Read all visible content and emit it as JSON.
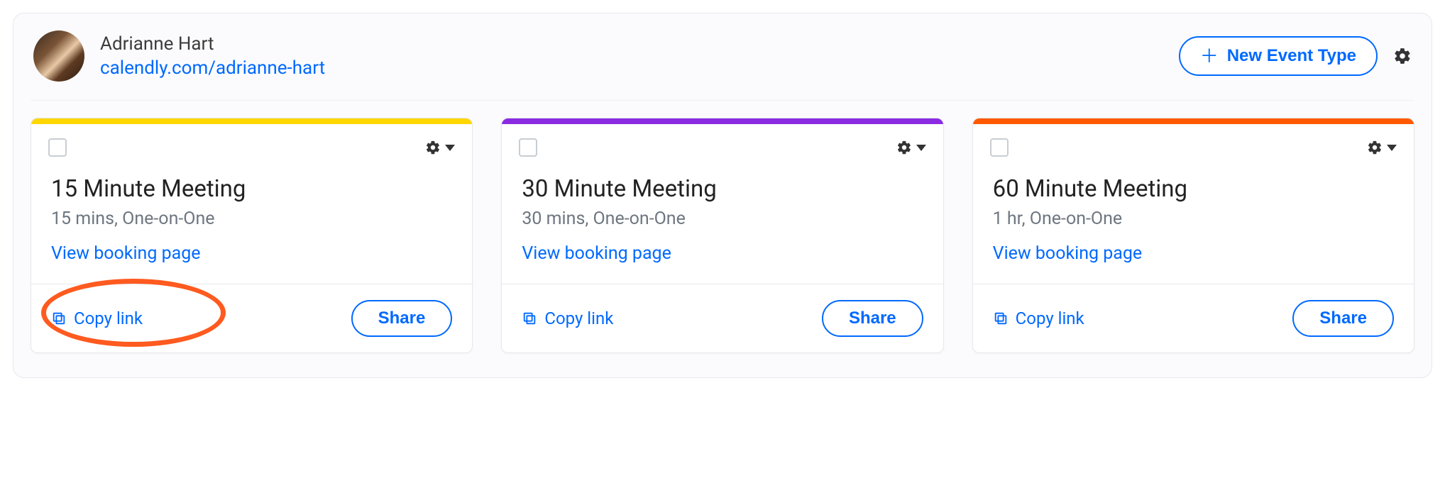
{
  "header": {
    "user_name": "Adrianne Hart",
    "user_link": "calendly.com/adrianne-hart",
    "new_event_label": "New Event Type"
  },
  "cards": [
    {
      "stripe_color": "#ffd600",
      "title": "15 Minute Meeting",
      "subtitle": "15 mins, One-on-One",
      "view_label": "View booking page",
      "copy_label": "Copy link",
      "share_label": "Share",
      "highlighted": true
    },
    {
      "stripe_color": "#8a2be2",
      "title": "30 Minute Meeting",
      "subtitle": "30 mins, One-on-One",
      "view_label": "View booking page",
      "copy_label": "Copy link",
      "share_label": "Share",
      "highlighted": false
    },
    {
      "stripe_color": "#ff5a00",
      "title": "60 Minute Meeting",
      "subtitle": "1 hr, One-on-One",
      "view_label": "View booking page",
      "copy_label": "Copy link",
      "share_label": "Share",
      "highlighted": false
    }
  ]
}
